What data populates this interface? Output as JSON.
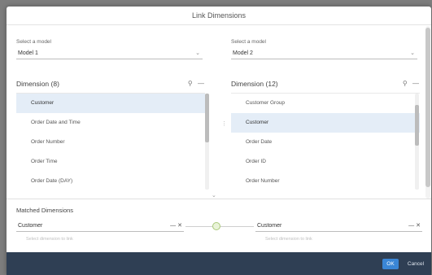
{
  "dialog": {
    "title": "Link Dimensions"
  },
  "left": {
    "model_label": "Select a model",
    "model_value": "Model 1",
    "panel_title": "Dimension (8)",
    "items": [
      {
        "label": "Customer",
        "selected": true
      },
      {
        "label": "Order Date and Time",
        "selected": false
      },
      {
        "label": "Order Number",
        "selected": false
      },
      {
        "label": "Order Time",
        "selected": false
      },
      {
        "label": "Order Date (DAY)",
        "selected": false
      }
    ]
  },
  "right": {
    "model_label": "Select a model",
    "model_value": "Model 2",
    "panel_title": "Dimension (12)",
    "items": [
      {
        "label": "Customer Group",
        "selected": false
      },
      {
        "label": "Customer",
        "selected": true
      },
      {
        "label": "Order Date",
        "selected": false
      },
      {
        "label": "Order ID",
        "selected": false
      },
      {
        "label": "Order Number",
        "selected": false
      }
    ]
  },
  "matched": {
    "title": "Matched Dimensions",
    "left_value": "Customer",
    "right_value": "Customer",
    "left_hint": "Select dimension to link",
    "right_hint": "Select dimension to link"
  },
  "footer": {
    "ok_label": "OK",
    "cancel_label": "Cancel"
  },
  "icons": {
    "search": "search-icon",
    "collapse": "collapse-icon",
    "chevron": "chevron-down-icon",
    "remove": "close-icon",
    "link": "link-icon"
  },
  "colors": {
    "footer_bg": "#2f3f54",
    "accent": "#3a86d6",
    "selected_row": "#e4edf7",
    "link_dot": "#e9f3d8"
  }
}
